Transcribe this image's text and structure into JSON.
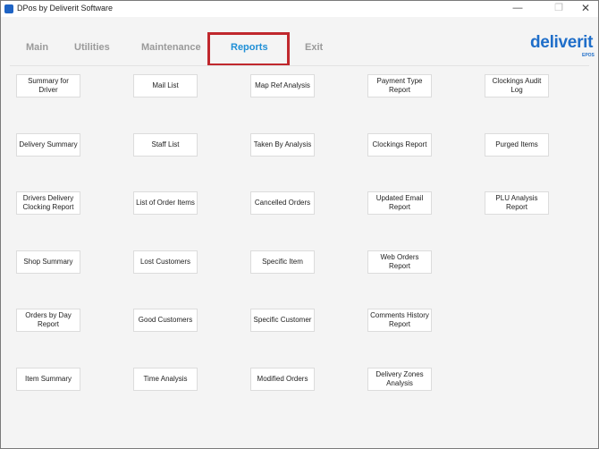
{
  "window": {
    "title": "DPos by Deliverit Software",
    "minimize": "—",
    "maximize": "❐",
    "close": "✕"
  },
  "tabs": {
    "main": "Main",
    "utilities": "Utilities",
    "maintenance": "Maintenance",
    "reports": "Reports",
    "exit": "Exit"
  },
  "logo": {
    "text": "deliverit",
    "sub": "EPOS"
  },
  "colors": {
    "accent": "#1f8fd6",
    "highlight": "#c0282d",
    "logo": "#1f6ec9"
  },
  "reports": {
    "summary_for_driver": "Summary for Driver",
    "mail_list": "Mail List",
    "map_ref_analysis": "Map Ref Analysis",
    "payment_type_report": "Payment Type Report",
    "clockings_audit_log": "Clockings Audit Log",
    "delivery_summary": "Delivery Summary",
    "staff_list": "Staff List",
    "taken_by_analysis": "Taken By Analysis",
    "clockings_report": "Clockings Report",
    "purged_items": "Purged Items",
    "drivers_delivery_clocking_report": "Drivers Delivery Clocking Report",
    "list_of_order_items": "List of Order Items",
    "cancelled_orders": "Cancelled Orders",
    "updated_email_report": "Updated Email Report",
    "plu_analysis_report": "PLU Analysis Report",
    "shop_summary": "Shop Summary",
    "lost_customers": "Lost Customers",
    "specific_item": "Specific Item",
    "web_orders_report": "Web Orders Report",
    "orders_by_day_report": "Orders by Day Report",
    "good_customers": "Good Customers",
    "specific_customer": "Specific Customer",
    "comments_history_report": "Comments History Report",
    "item_summary": "Item Summary",
    "time_analysis": "Time Analysis",
    "modified_orders": "Modified Orders",
    "delivery_zones_analysis": "Delivery Zones Analysis"
  }
}
